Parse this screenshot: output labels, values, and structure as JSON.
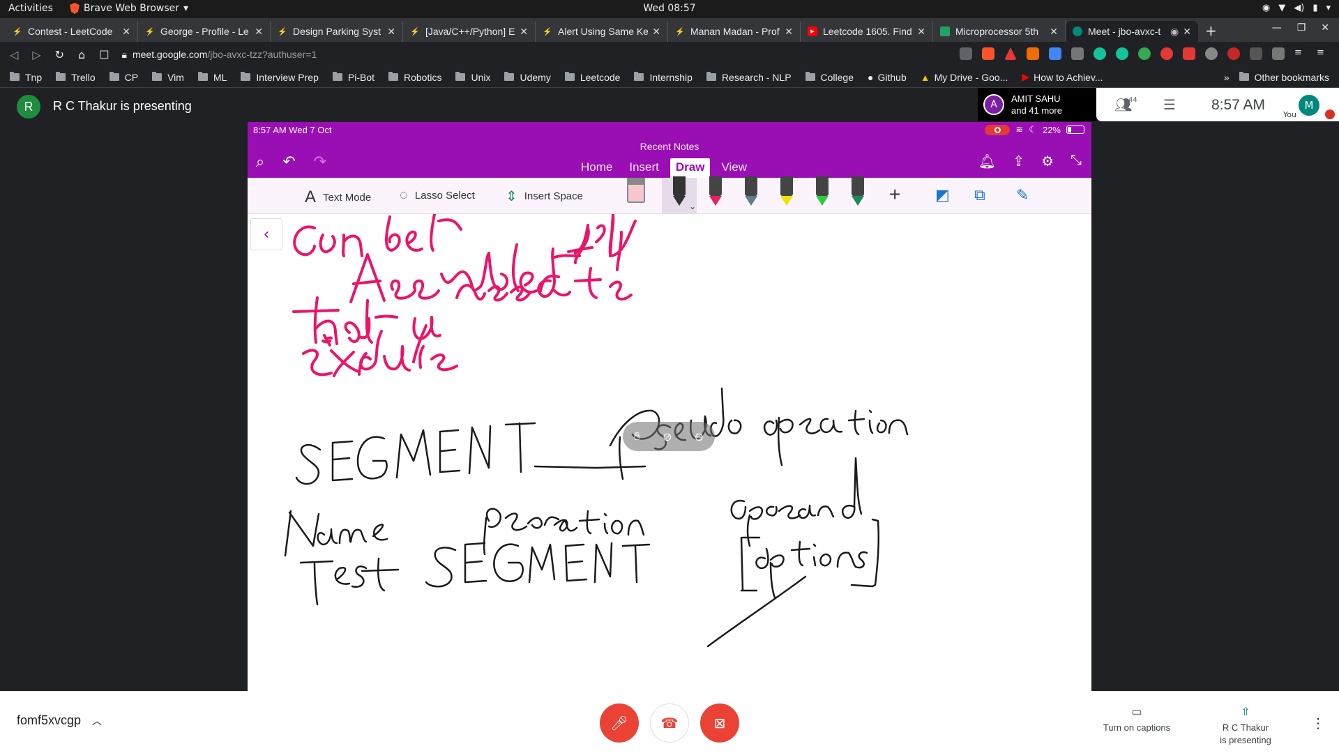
{
  "topbar": {
    "activities": "Activities",
    "app_name": "Brave Web Browser",
    "clock": "Wed 08:57"
  },
  "tabs": [
    {
      "title": "Contest - LeetCode"
    },
    {
      "title": "George - Profile - Le"
    },
    {
      "title": "Design Parking Syst"
    },
    {
      "title": "[Java/C++/Python] E"
    },
    {
      "title": "Alert Using Same Ke"
    },
    {
      "title": "Manan Madan - Prof"
    },
    {
      "title": "Leetcode 1605. Find"
    },
    {
      "title": "Microprocessor 5th"
    },
    {
      "title": "Meet - jbo-avxc-t"
    }
  ],
  "address": {
    "host": "meet.google.com",
    "path": "/jbo-avxc-tzz?authuser=1"
  },
  "bookmarks": [
    "Tnp",
    "Trello",
    "CP",
    "Vim",
    "ML",
    "Interview Prep",
    "Pi-Bot",
    "Robotics",
    "Unix",
    "Udemy",
    "Leetcode",
    "Internship",
    "Research - NLP",
    "College"
  ],
  "bookmark_links": {
    "github": "Github",
    "drive": "My Drive - Goo...",
    "howto": "How to Achiev...",
    "more": "»",
    "other": "Other bookmarks"
  },
  "meet": {
    "presenter_initial": "R",
    "presenting_label": "R C Thakur is presenting",
    "participant_initial": "A",
    "participant_name": "AMIT SAHU",
    "participant_more": "and 41 more",
    "people_count": "44",
    "time": "8:57 AM",
    "me_initial": "M",
    "you_label": "You",
    "meeting_code": "fomf5xvcgp",
    "captions_label": "Turn on captions",
    "presenting_name": "R C Thakur",
    "presenting_sub": "is presenting"
  },
  "ipad": {
    "time_date": "8:57 AM   Wed 7 Oct",
    "battery": "22%",
    "recent_notes": "Recent Notes",
    "tabs": [
      "Home",
      "Insert",
      "Draw",
      "View"
    ],
    "active_tab": "Draw",
    "tools": {
      "text_mode": "Text Mode",
      "lasso": "Lasso Select",
      "insert_space": "Insert Space"
    }
  },
  "colors": {
    "onenote_purple": "#9a0fb4",
    "ink_pink": "#ec1469",
    "ink_black": "#1a1a1a",
    "meet_red": "#ea4335",
    "pens": [
      "#333333",
      "#e91e63",
      "#607d8b",
      "#f4e000",
      "#2ecc40",
      "#1b8a5a"
    ]
  },
  "icons": [
    "search-icon",
    "undo-icon",
    "redo-icon",
    "bell-icon",
    "share-icon",
    "gear-icon",
    "collapse-icon",
    "mic-off-icon",
    "hang-up-icon",
    "camera-off-icon",
    "captions-icon",
    "present-icon",
    "more-icon"
  ]
}
